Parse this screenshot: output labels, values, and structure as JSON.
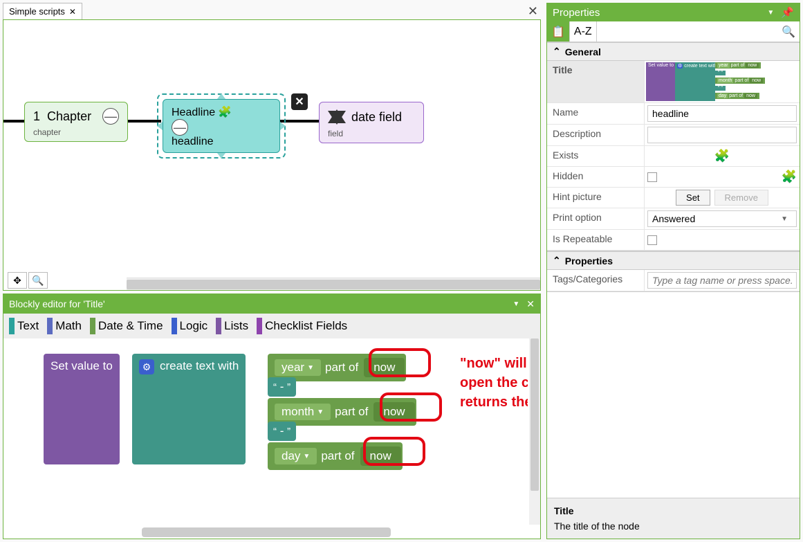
{
  "tabs": {
    "active": "Simple scripts"
  },
  "canvas": {
    "nodes": {
      "chapter": {
        "num": "1",
        "title": "Chapter",
        "sub": "chapter"
      },
      "headline": {
        "title": "Headline",
        "sub": "headline"
      },
      "field": {
        "title": "date field",
        "sub": "field"
      }
    },
    "tools": {
      "move": "✥",
      "zoom": "🔍"
    }
  },
  "blockly": {
    "title": "Blockly editor for 'Title'",
    "categories": [
      {
        "label": "Text",
        "color": "#2aa19c"
      },
      {
        "label": "Math",
        "color": "#5c6bc0"
      },
      {
        "label": "Date & Time",
        "color": "#6b9e4a"
      },
      {
        "label": "Logic",
        "color": "#3a5fcd"
      },
      {
        "label": "Lists",
        "color": "#7e57a3"
      },
      {
        "label": "Checklist Fields",
        "color": "#8e44ad"
      }
    ],
    "blocks": {
      "set_value": "Set value to",
      "create_text": "create text with",
      "year": "year",
      "month": "month",
      "day": "day",
      "part_of": "part  of",
      "now": "now",
      "sep": "\" - \""
    },
    "annotation": "\"now\" will be every time we open the checklist and returns the current date"
  },
  "props": {
    "title": "Properties",
    "sort": "A-Z",
    "sections": {
      "general": "General",
      "properties": "Properties"
    },
    "rows": {
      "title": {
        "label": "Title"
      },
      "name": {
        "label": "Name",
        "value": "headline"
      },
      "description": {
        "label": "Description",
        "value": ""
      },
      "exists": {
        "label": "Exists"
      },
      "hidden": {
        "label": "Hidden"
      },
      "hint": {
        "label": "Hint picture",
        "set": "Set",
        "remove": "Remove"
      },
      "print": {
        "label": "Print option",
        "value": "Answered"
      },
      "repeat": {
        "label": "Is Repeatable"
      },
      "tags": {
        "label": "Tags/Categories",
        "placeholder": "Type a tag name or press space."
      }
    },
    "mini": {
      "set": "Set value to",
      "gear": "⚙",
      "create": "create text with",
      "year": "year",
      "month": "month",
      "day": "day",
      "part": "part  of",
      "now": "now",
      "sep": "\" \""
    },
    "help": {
      "title": "Title",
      "body": "The title of the node"
    }
  }
}
